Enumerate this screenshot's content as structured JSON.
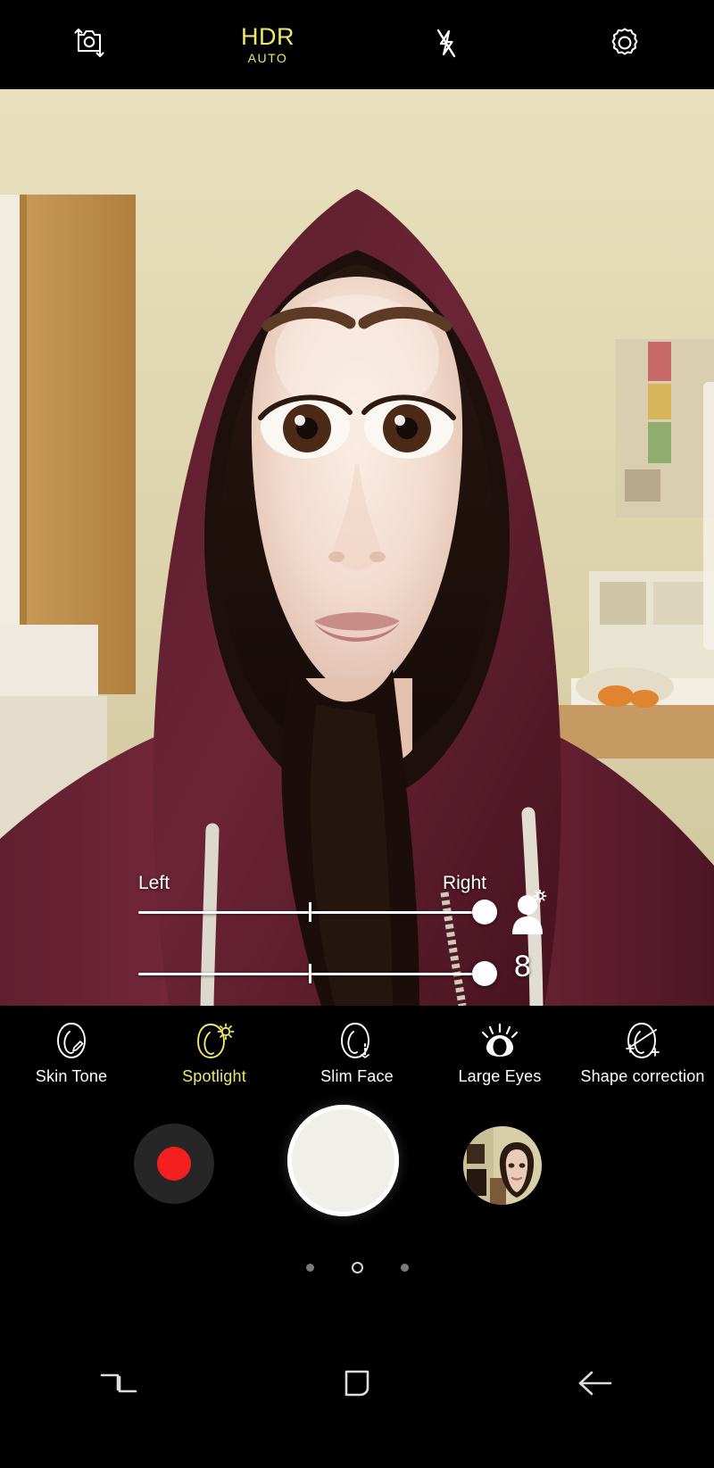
{
  "topbar": {
    "camera_switch": {
      "icon": "camera-switch-icon",
      "label": "Switch camera"
    },
    "hdr": {
      "icon": "hdr-icon",
      "main": "HDR",
      "sub": "AUTO",
      "color": "#ece96a"
    },
    "flash": {
      "icon": "flash-off-icon",
      "label": "Flash off"
    },
    "settings": {
      "icon": "gear-icon",
      "label": "Settings"
    }
  },
  "viewfinder": {
    "description": "Front-facing camera selfie preview: woman wearing a maroon hooded sweatshirt with white drawstrings, long dark brown hair, against a cream-yellow wall with a wooden door on the left and shelving on the right",
    "scroll_handle": "viewfinder-edge-handle"
  },
  "spotlight_control": {
    "left_label": "Left",
    "right_label": "Right",
    "value": "8",
    "person_icon": "person-spotlight-icon",
    "sliders": [
      {
        "name": "direction",
        "position_percent": 100,
        "center_tick_percent": 49
      },
      {
        "name": "intensity",
        "position_percent": 100,
        "center_tick_percent": 49
      }
    ]
  },
  "beauty_modes": {
    "active_color": "#ece96a",
    "items": [
      {
        "label": "Skin Tone",
        "icon": "face-skin-tone-icon",
        "active": false
      },
      {
        "label": "Spotlight",
        "icon": "face-spotlight-icon",
        "active": true
      },
      {
        "label": "Slim Face",
        "icon": "face-slim-icon",
        "active": false
      },
      {
        "label": "Large Eyes",
        "icon": "eye-large-icon",
        "active": false
      },
      {
        "label": "Shape correction",
        "icon": "face-shape-correction-icon",
        "active": false
      }
    ]
  },
  "capture": {
    "record_button": {
      "icon": "record-icon",
      "label": "Record video",
      "dot_color": "#f42020"
    },
    "shutter_button": {
      "icon": "shutter-icon",
      "label": "Take picture"
    },
    "gallery_button": {
      "icon": "gallery-thumbnail-icon",
      "label": "Gallery preview"
    }
  },
  "page_dots": {
    "count": 3,
    "active_index": 1
  },
  "navbar": {
    "recents": {
      "icon": "recents-icon",
      "label": "Recents"
    },
    "home": {
      "icon": "home-icon",
      "label": "Home"
    },
    "back": {
      "icon": "back-arrow-icon",
      "label": "Back"
    }
  }
}
